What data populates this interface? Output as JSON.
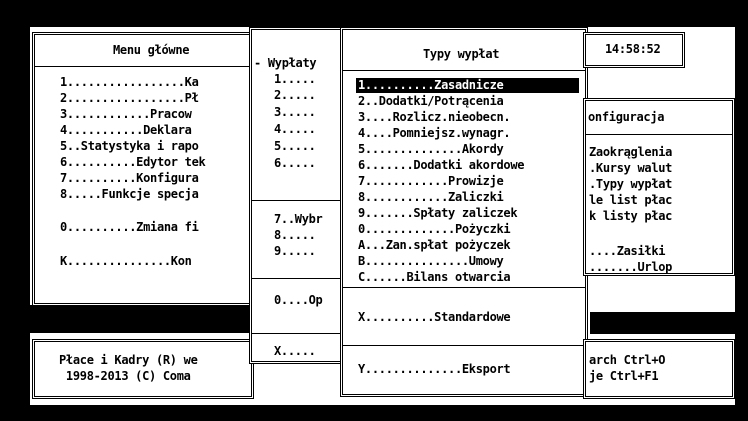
{
  "clock": "14:58:52",
  "main_menu": {
    "title": "Menu główne",
    "items": [
      "1.................Ka",
      "2.................Pł",
      "3............Pracow",
      "4...........Deklara",
      "5..Statystyka i rapo",
      "6..........Edytor tek",
      "7..........Konfigura",
      "8.....Funkcje specja"
    ],
    "zero": "0..........Zmiana fi",
    "k": "K...............Kon"
  },
  "payouts_menu": {
    "title": "Wypłaty",
    "items": [
      "1.....",
      "2.....",
      "3.....",
      "4.....",
      "5.....",
      "6....."
    ],
    "group2": [
      "7..Wybr",
      "8.....",
      "9....."
    ],
    "zero": "0....Op",
    "x": "X....."
  },
  "types_menu": {
    "title": "Typy wypłat",
    "items": [
      "1..........Zasadnicze",
      "2..Dodatki/Potrącenia",
      "3....Rozlicz.nieobecn.",
      "4....Pomniejsz.wynagr.",
      "5..............Akordy",
      "6.......Dodatki akordowe",
      "7............Prowizje",
      "8............Zaliczki",
      "9.......Spłaty zaliczek",
      "0.............Pożyczki",
      "A...Zan.spłat pożyczek",
      "B...............Umowy",
      "C......Bilans otwarcia"
    ],
    "selected_index": 0,
    "standard": "X..........Standardowe",
    "export": "Y..............Eksport"
  },
  "config_menu": {
    "title": "onfiguracja",
    "items": [
      "Zaokrąglenia",
      ".Kursy walut",
      ".Typy wypłat",
      "le list płac",
      "k listy płac"
    ],
    "extra": [
      "....Zasiłki",
      ".......Urlop"
    ]
  },
  "status": {
    "left_line1": "Płace i Kadry (R) we",
    "left_line2": " 1998-2013 (C) Coma",
    "right_line1": "arch Ctrl+O",
    "right_line2": "je Ctrl+F1"
  }
}
